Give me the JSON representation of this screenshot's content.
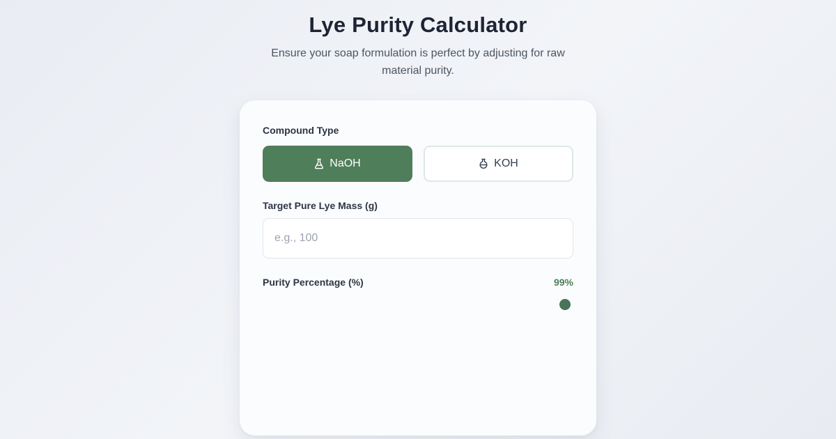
{
  "header": {
    "title": "Lye Purity Calculator",
    "subtitle": "Ensure your soap formulation is perfect by adjusting for raw material purity."
  },
  "form": {
    "compound": {
      "label": "Compound Type",
      "options": [
        {
          "label": "NaOH",
          "icon": "flask-icon",
          "selected": true
        },
        {
          "label": "KOH",
          "icon": "beaker-icon",
          "selected": false
        }
      ]
    },
    "mass": {
      "label": "Target Pure Lye Mass (g)",
      "value": "",
      "placeholder": "e.g., 100"
    },
    "purity": {
      "label": "Purity Percentage (%)",
      "display": "99%",
      "value": 99
    }
  },
  "colors": {
    "accent": "#4f7e5a",
    "title": "#1e2435",
    "background": "#eef1f5"
  }
}
